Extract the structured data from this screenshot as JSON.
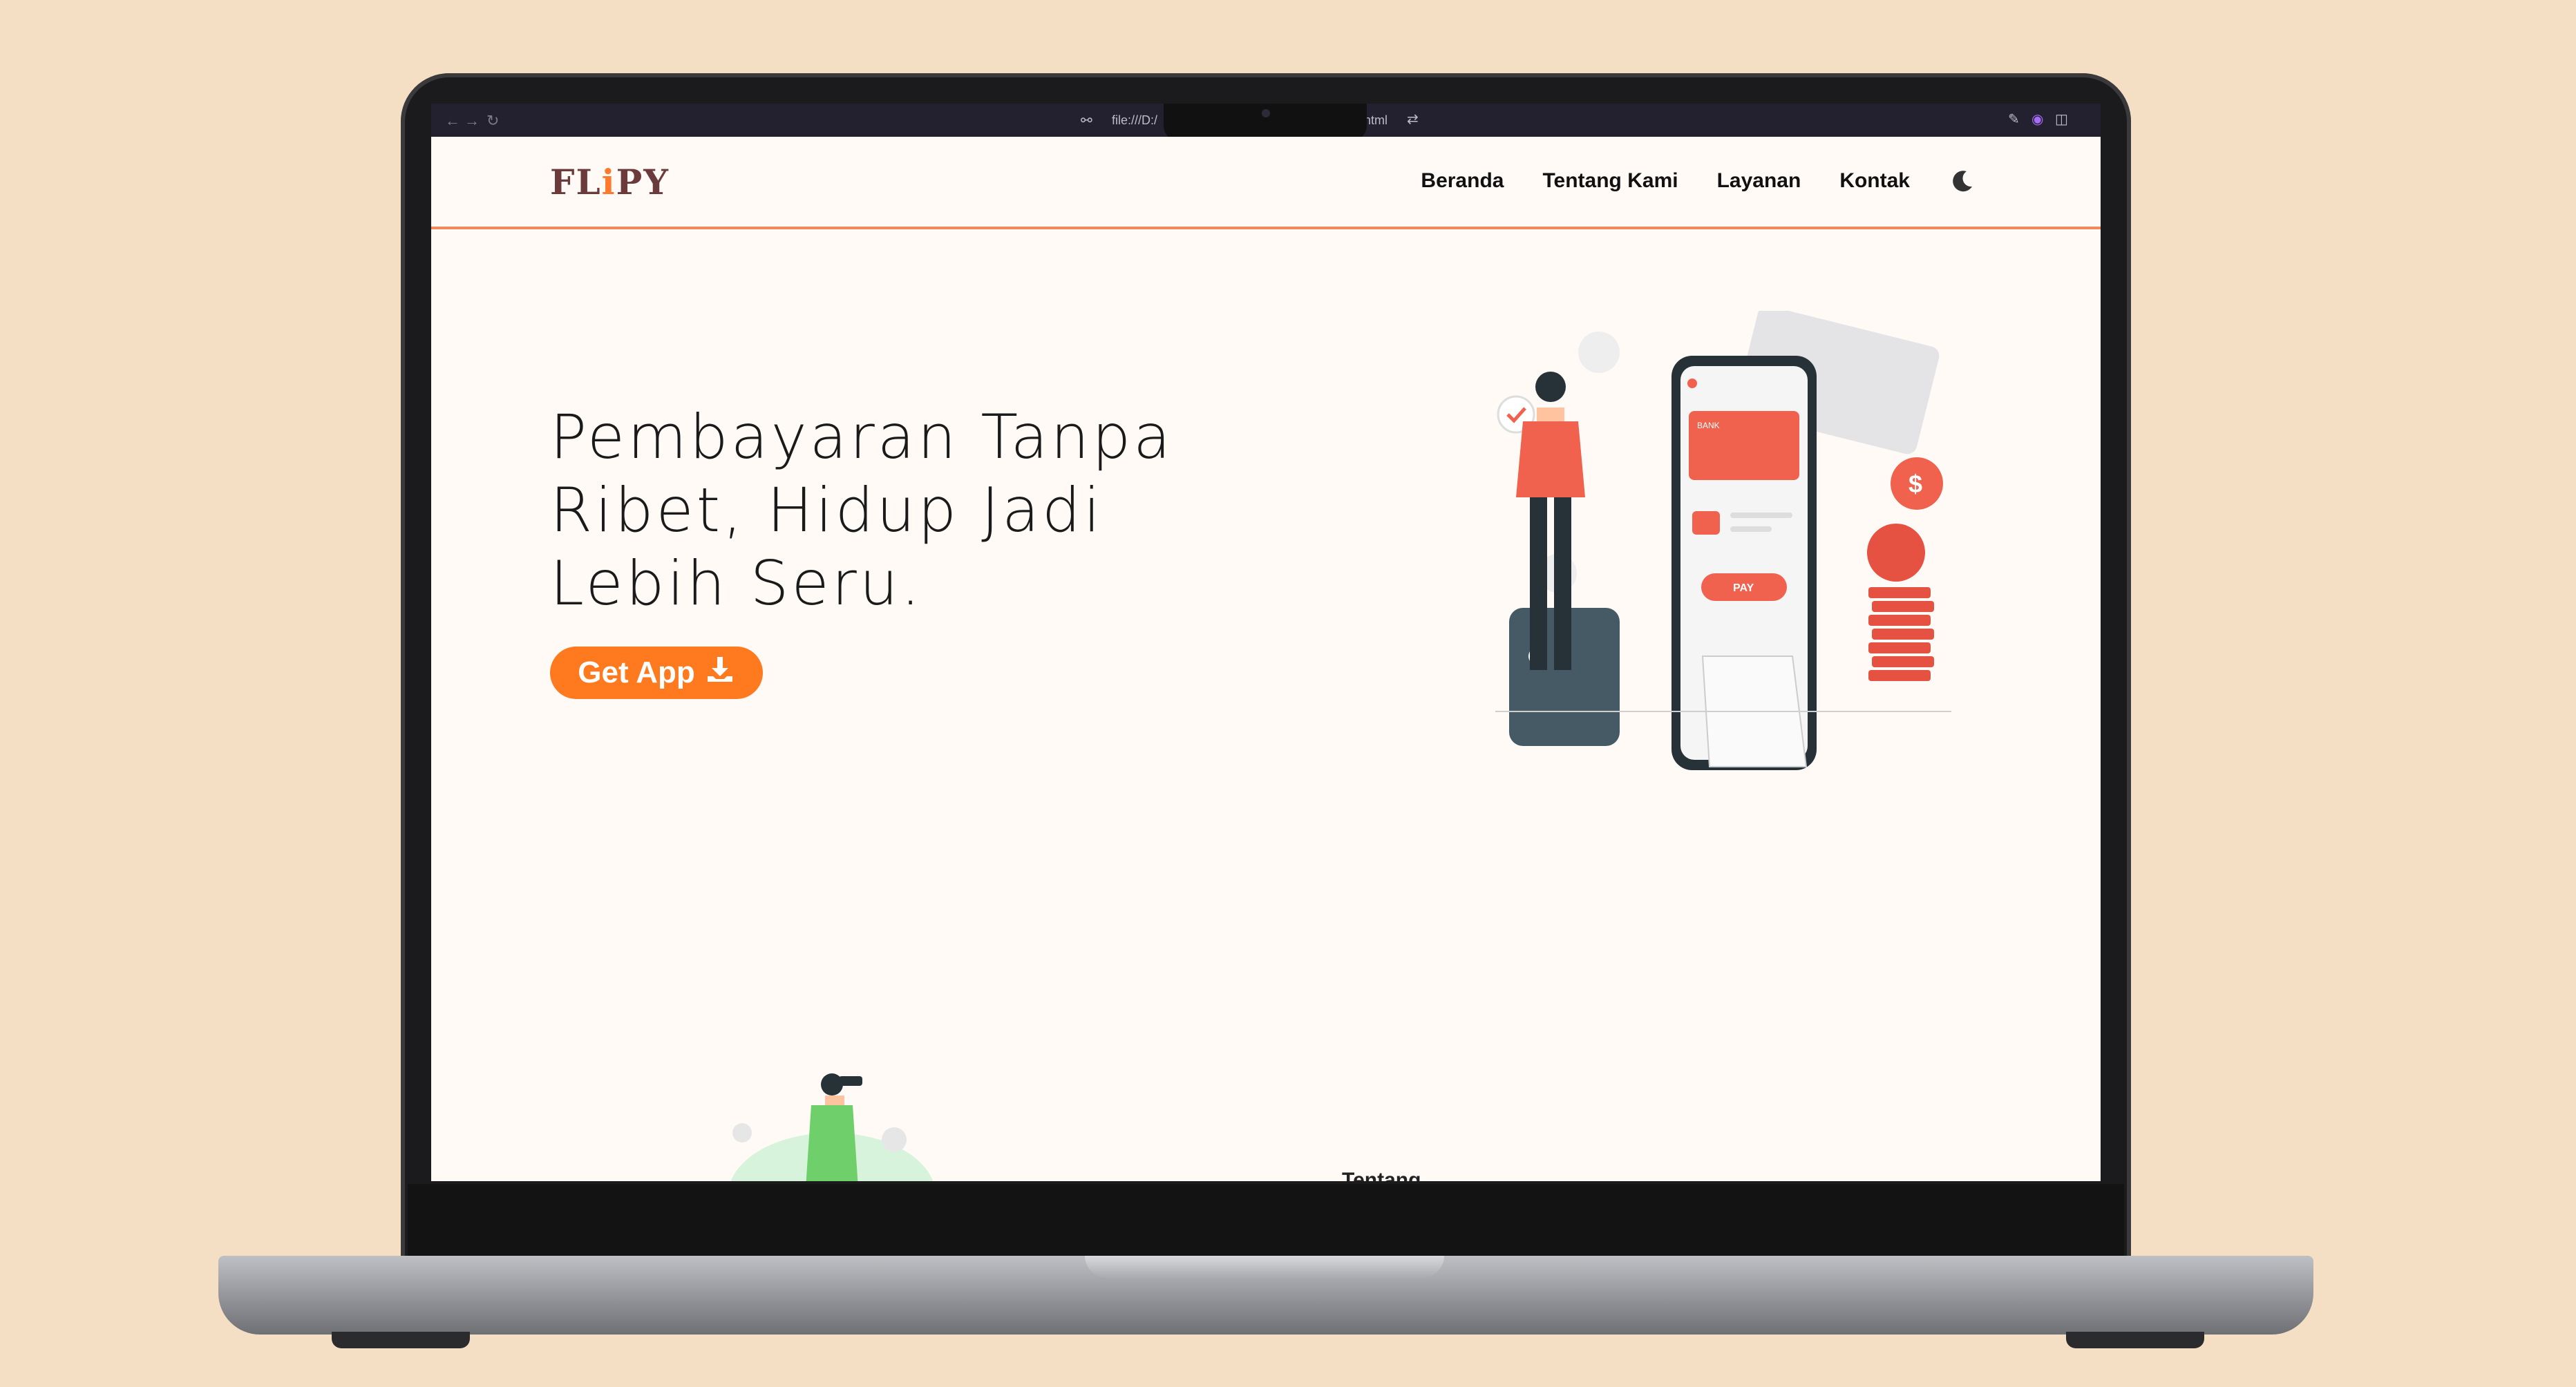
{
  "browser": {
    "url_left": "file:///D:/",
    "url_right": "html"
  },
  "site": {
    "logo_prefix": "FL",
    "logo_i": "i",
    "logo_suffix": "PY",
    "nav": [
      "Beranda",
      "Tentang Kami",
      "Layanan",
      "Kontak"
    ],
    "theme_toggle_icon": "moon-icon"
  },
  "hero": {
    "title": "Pembayaran Tanpa Ribet, Hidup Jadi Lebih Seru.",
    "cta_label": "Get App",
    "cta_icon": "download-icon",
    "illustration": {
      "card_label": "BANK",
      "pay_label": "PAY"
    }
  },
  "next_section": {
    "heading_peek": "Tentang"
  },
  "colors": {
    "accent": "#ff7a1e",
    "logo": "#6b3a3a",
    "background": "#fffaf6",
    "page_backdrop": "#f4dfc5"
  }
}
